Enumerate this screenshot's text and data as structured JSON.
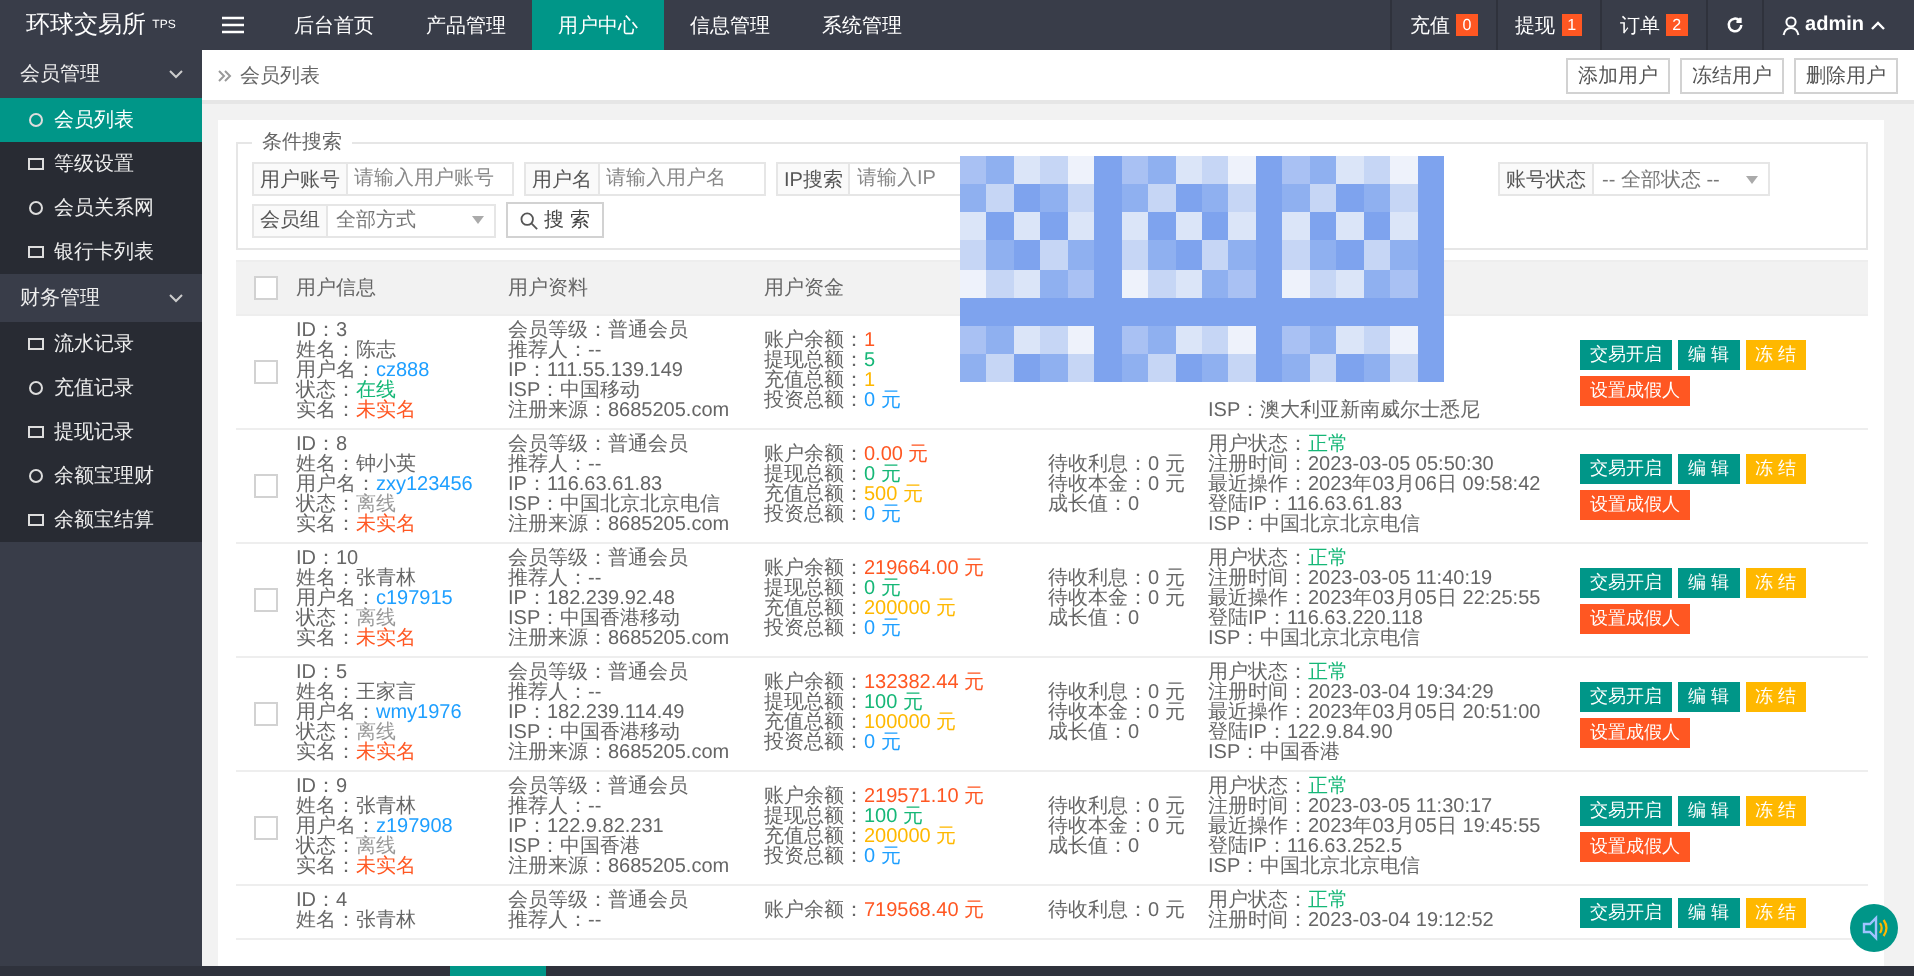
{
  "logo": "环球交易所$^{TPS}$",
  "nav": [
    {
      "label": "后台首页",
      "selected": false
    },
    {
      "label": "产品管理",
      "selected": false
    },
    {
      "label": "用户中心",
      "selected": true
    },
    {
      "label": "信息管理",
      "selected": false
    },
    {
      "label": "系统管理",
      "selected": false
    }
  ],
  "counters": [
    {
      "label": "充值",
      "count": "0"
    },
    {
      "label": "提现",
      "count": "1"
    },
    {
      "label": "订单",
      "count": "2"
    }
  ],
  "user": "admin",
  "sidebar": [
    {
      "label": "会员管理",
      "expanded": true,
      "children": [
        {
          "label": "会员列表",
          "selected": true
        },
        {
          "label": "等级设置",
          "selected": false
        },
        {
          "label": "会员关系网",
          "selected": false
        },
        {
          "label": "银行卡列表",
          "selected": false
        }
      ]
    },
    {
      "label": "财务管理",
      "expanded": true,
      "children": [
        {
          "label": "流水记录",
          "selected": false
        },
        {
          "label": "充值记录",
          "selected": false
        },
        {
          "label": "提现记录",
          "selected": false
        },
        {
          "label": "余额宝理财",
          "selected": false
        },
        {
          "label": "余额宝结算",
          "selected": false
        }
      ]
    }
  ],
  "breadcrumb": "会员列表",
  "toolbar": [
    "添加用户",
    "冻结用户",
    "删除用户"
  ],
  "search": {
    "legend": "条件搜索",
    "fields": [
      {
        "label": "用户账号",
        "placeholder": "请输入用户账号"
      },
      {
        "label": "用户名",
        "placeholder": "请输入用户名"
      },
      {
        "label": "IP搜索",
        "placeholder": "请输入IP"
      }
    ],
    "status": {
      "label": "账号状态",
      "value": "-- 全部状态 --"
    },
    "group": {
      "label": "会员组",
      "value": "全部方式"
    },
    "button": "搜 索"
  },
  "table": {
    "header_checked": false,
    "columns": [
      "用户信息",
      "用户资料",
      "用户资金"
    ],
    "rows": [
      {
        "checked": false,
        "info": [
          {
            "text": "ID：3"
          },
          {
            "text": "姓名：陈志"
          },
          {
            "label": "用户名：",
            "value": "cz888",
            "color": "#1e9fff"
          },
          {
            "label": "状态：",
            "value": "在线",
            "color": "#16b777"
          },
          {
            "label": "实名：",
            "value": "未实名",
            "color": "#ff5722"
          }
        ],
        "profile": [
          {
            "text": "会员等级：普通会员"
          },
          {
            "text": "推荐人：--"
          },
          {
            "text": "IP：111.55.139.149"
          },
          {
            "text": "ISP：中国移动"
          },
          {
            "text": "注册来源：8685205.com"
          }
        ],
        "funds": [
          {
            "label": "账户余额：",
            "value": "1",
            "color": "#ff5722"
          },
          {
            "label": "提现总额：",
            "value": "5",
            "color": "#16b777"
          },
          {
            "label": "充值总额：",
            "value": "1",
            "color": "#ffb800"
          },
          {
            "label": "投资总额：",
            "value": "0 元",
            "color": "#1e9fff"
          }
        ],
        "income": [],
        "login": [
          {
            "text": "ISP：澳大利亚新南威尔士悉尼"
          }
        ],
        "actions": [
          {
            "kind": "open",
            "label": "交易开启"
          },
          {
            "kind": "edit",
            "label": "编 辑"
          },
          {
            "kind": "freeze",
            "label": "冻 结"
          },
          {
            "kind": "fake",
            "label": "设置成假人"
          }
        ]
      },
      {
        "checked": false,
        "info": [
          {
            "text": "ID：8"
          },
          {
            "text": "姓名：钟小英"
          },
          {
            "label": "用户名：",
            "value": "zxy123456",
            "color": "#1e9fff"
          },
          {
            "label": "状态：",
            "value": "离线",
            "color": "#999999"
          },
          {
            "label": "实名：",
            "value": "未实名",
            "color": "#ff5722"
          }
        ],
        "profile": [
          {
            "text": "会员等级：普通会员"
          },
          {
            "text": "推荐人：--"
          },
          {
            "text": "IP：116.63.61.83"
          },
          {
            "text": "ISP：中国北京北京电信"
          },
          {
            "text": "注册来源：8685205.com"
          }
        ],
        "funds": [
          {
            "label": "账户余额：",
            "value": "0.00 元",
            "color": "#ff5722"
          },
          {
            "label": "提现总额：",
            "value": "0 元",
            "color": "#16b777"
          },
          {
            "label": "充值总额：",
            "value": "500 元",
            "color": "#ffb800"
          },
          {
            "label": "投资总额：",
            "value": "0 元",
            "color": "#1e9fff"
          }
        ],
        "income": [
          {
            "text": "待收利息：0 元"
          },
          {
            "text": "待收本金：0 元"
          },
          {
            "text": "成长值：0"
          }
        ],
        "login": [
          {
            "label": "用户状态：",
            "value": "正常",
            "color": "#16b777"
          },
          {
            "text": "注册时间：2023-03-05 05:50:30"
          },
          {
            "text": "最近操作：2023年03月06日 09:58:42"
          },
          {
            "text": "登陆IP：116.63.61.83"
          },
          {
            "text": "ISP：中国北京北京电信"
          }
        ],
        "actions": [
          {
            "kind": "open",
            "label": "交易开启"
          },
          {
            "kind": "edit",
            "label": "编 辑"
          },
          {
            "kind": "freeze",
            "label": "冻 结"
          },
          {
            "kind": "fake",
            "label": "设置成假人"
          }
        ]
      },
      {
        "checked": false,
        "info": [
          {
            "text": "ID：10"
          },
          {
            "text": "姓名：张青林"
          },
          {
            "label": "用户名：",
            "value": "c197915",
            "color": "#1e9fff"
          },
          {
            "label": "状态：",
            "value": "离线",
            "color": "#999999"
          },
          {
            "label": "实名：",
            "value": "未实名",
            "color": "#ff5722"
          }
        ],
        "profile": [
          {
            "text": "会员等级：普通会员"
          },
          {
            "text": "推荐人：--"
          },
          {
            "text": "IP：182.239.92.48"
          },
          {
            "text": "ISP：中国香港移动"
          },
          {
            "text": "注册来源：8685205.com"
          }
        ],
        "funds": [
          {
            "label": "账户余额：",
            "value": "219664.00 元",
            "color": "#ff5722"
          },
          {
            "label": "提现总额：",
            "value": "0 元",
            "color": "#16b777"
          },
          {
            "label": "充值总额：",
            "value": "200000 元",
            "color": "#ffb800"
          },
          {
            "label": "投资总额：",
            "value": "0 元",
            "color": "#1e9fff"
          }
        ],
        "income": [
          {
            "text": "待收利息：0 元"
          },
          {
            "text": "待收本金：0 元"
          },
          {
            "text": "成长值：0"
          }
        ],
        "login": [
          {
            "label": "用户状态：",
            "value": "正常",
            "color": "#16b777"
          },
          {
            "text": "注册时间：2023-03-05 11:40:19"
          },
          {
            "text": "最近操作：2023年03月05日 22:25:55"
          },
          {
            "text": "登陆IP：116.63.220.118"
          },
          {
            "text": "ISP：中国北京北京电信"
          }
        ],
        "actions": [
          {
            "kind": "open",
            "label": "交易开启"
          },
          {
            "kind": "edit",
            "label": "编 辑"
          },
          {
            "kind": "freeze",
            "label": "冻 结"
          },
          {
            "kind": "fake",
            "label": "设置成假人"
          }
        ]
      },
      {
        "checked": false,
        "info": [
          {
            "text": "ID：5"
          },
          {
            "text": "姓名：王家言"
          },
          {
            "label": "用户名：",
            "value": "wmy1976",
            "color": "#1e9fff"
          },
          {
            "label": "状态：",
            "value": "离线",
            "color": "#999999"
          },
          {
            "label": "实名：",
            "value": "未实名",
            "color": "#ff5722"
          }
        ],
        "profile": [
          {
            "text": "会员等级：普通会员"
          },
          {
            "text": "推荐人：--"
          },
          {
            "text": "IP：182.239.114.49"
          },
          {
            "text": "ISP：中国香港移动"
          },
          {
            "text": "注册来源：8685205.com"
          }
        ],
        "funds": [
          {
            "label": "账户余额：",
            "value": "132382.44 元",
            "color": "#ff5722"
          },
          {
            "label": "提现总额：",
            "value": "100 元",
            "color": "#16b777"
          },
          {
            "label": "充值总额：",
            "value": "100000 元",
            "color": "#ffb800"
          },
          {
            "label": "投资总额：",
            "value": "0 元",
            "color": "#1e9fff"
          }
        ],
        "income": [
          {
            "text": "待收利息：0 元"
          },
          {
            "text": "待收本金：0 元"
          },
          {
            "text": "成长值：0"
          }
        ],
        "login": [
          {
            "label": "用户状态：",
            "value": "正常",
            "color": "#16b777"
          },
          {
            "text": "注册时间：2023-03-04 19:34:29"
          },
          {
            "text": "最近操作：2023年03月05日 20:51:00"
          },
          {
            "text": "登陆IP：122.9.84.90"
          },
          {
            "text": "ISP：中国香港"
          }
        ],
        "actions": [
          {
            "kind": "open",
            "label": "交易开启"
          },
          {
            "kind": "edit",
            "label": "编 辑"
          },
          {
            "kind": "freeze",
            "label": "冻 结"
          },
          {
            "kind": "fake",
            "label": "设置成假人"
          }
        ]
      },
      {
        "checked": false,
        "info": [
          {
            "text": "ID：9"
          },
          {
            "text": "姓名：张青林"
          },
          {
            "label": "用户名：",
            "value": "z197908",
            "color": "#1e9fff"
          },
          {
            "label": "状态：",
            "value": "离线",
            "color": "#999999"
          },
          {
            "label": "实名：",
            "value": "未实名",
            "color": "#ff5722"
          }
        ],
        "profile": [
          {
            "text": "会员等级：普通会员"
          },
          {
            "text": "推荐人：--"
          },
          {
            "text": "IP：122.9.82.231"
          },
          {
            "text": "ISP：中国香港"
          },
          {
            "text": "注册来源：8685205.com"
          }
        ],
        "funds": [
          {
            "label": "账户余额：",
            "value": "219571.10 元",
            "color": "#ff5722"
          },
          {
            "label": "提现总额：",
            "value": "100 元",
            "color": "#16b777"
          },
          {
            "label": "充值总额：",
            "value": "200000 元",
            "color": "#ffb800"
          },
          {
            "label": "投资总额：",
            "value": "0 元",
            "color": "#1e9fff"
          }
        ],
        "income": [
          {
            "text": "待收利息：0 元"
          },
          {
            "text": "待收本金：0 元"
          },
          {
            "text": "成长值：0"
          }
        ],
        "login": [
          {
            "label": "用户状态：",
            "value": "正常",
            "color": "#16b777"
          },
          {
            "text": "注册时间：2023-03-05 11:30:17"
          },
          {
            "text": "最近操作：2023年03月05日 19:45:55"
          },
          {
            "text": "登陆IP：116.63.252.5"
          },
          {
            "text": "ISP：中国北京北京电信"
          }
        ],
        "actions": [
          {
            "kind": "open",
            "label": "交易开启"
          },
          {
            "kind": "edit",
            "label": "编 辑"
          },
          {
            "kind": "freeze",
            "label": "冻 结"
          },
          {
            "kind": "fake",
            "label": "设置成假人"
          }
        ]
      },
      {
        "info": [
          {
            "text": "ID：4"
          },
          {
            "text": "姓名：张青林"
          }
        ],
        "profile": [
          {
            "text": "会员等级：普通会员"
          },
          {
            "text": "推荐人：--"
          }
        ],
        "funds": [
          {
            "label": "账户余额：",
            "value": "719568.40 元",
            "color": "#ff5722"
          }
        ],
        "income": [
          {
            "text": "待收利息：0 元"
          }
        ],
        "login": [
          {
            "label": "用户状态：",
            "value": "正常",
            "color": "#16b777"
          },
          {
            "text": "注册时间：2023-03-04 19:12:52"
          }
        ],
        "actions": [
          {
            "kind": "open",
            "label": "交易开启"
          },
          {
            "kind": "edit",
            "label": "编 辑"
          },
          {
            "kind": "freeze",
            "label": "冻 结"
          }
        ]
      }
    ]
  }
}
